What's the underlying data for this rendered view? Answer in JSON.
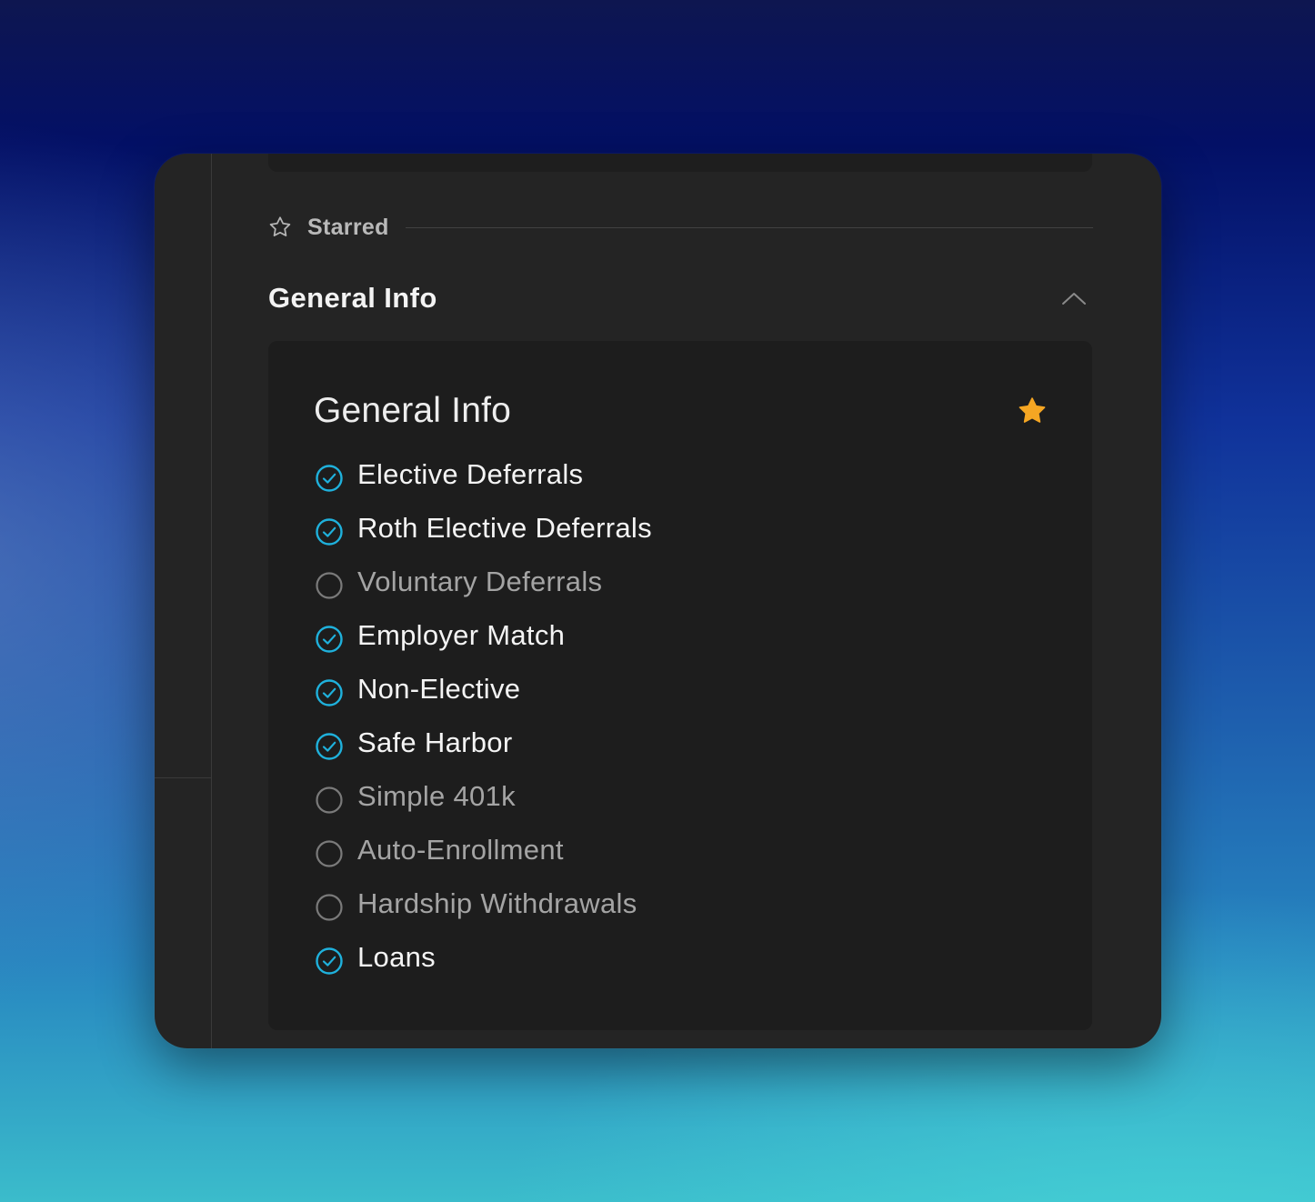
{
  "colors": {
    "accent_check": "#1fb1dc",
    "star_active": "#f5a623",
    "unchecked_ring": "#7a7a7a"
  },
  "starred": {
    "label": "Starred",
    "icon": "star-outline-icon"
  },
  "section": {
    "title": "General Info",
    "toggle_icon": "chevron-up-icon"
  },
  "card": {
    "title": "General Info",
    "favorite_icon": "star-filled-icon",
    "items": [
      {
        "label": "Elective Deferrals",
        "checked": true
      },
      {
        "label": "Roth Elective Deferrals",
        "checked": true
      },
      {
        "label": "Voluntary Deferrals",
        "checked": false
      },
      {
        "label": "Employer Match",
        "checked": true
      },
      {
        "label": "Non-Elective",
        "checked": true
      },
      {
        "label": "Safe Harbor",
        "checked": true
      },
      {
        "label": "Simple 401k",
        "checked": false
      },
      {
        "label": "Auto-Enrollment",
        "checked": false
      },
      {
        "label": "Hardship Withdrawals",
        "checked": false
      },
      {
        "label": "Loans",
        "checked": true
      }
    ]
  }
}
